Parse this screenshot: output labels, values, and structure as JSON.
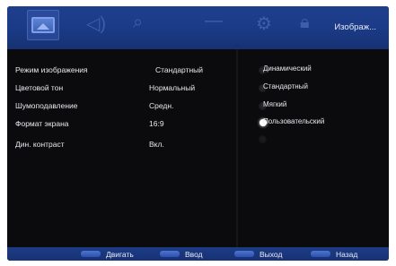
{
  "header": {
    "title": "Изображ..."
  },
  "settings": [
    {
      "label": "Режим изображения",
      "value": "Стандартный"
    },
    {
      "label": "Цветовой тон",
      "value": "Нормальный"
    },
    {
      "label": "Шумоподавление",
      "value": "Средн."
    },
    {
      "label": "Формат экрана",
      "value": "16:9"
    },
    {
      "label": "Дин. контраст",
      "value": "Вкл."
    }
  ],
  "options": [
    {
      "label": "Динамический",
      "selected": false
    },
    {
      "label": "Стандартный",
      "selected": false
    },
    {
      "label": "Мягкий",
      "selected": false
    },
    {
      "label": "Пользовательский",
      "selected": true
    }
  ],
  "footer": {
    "move": "Двигать",
    "enter": "Ввод",
    "exit": "Выход",
    "back": "Назад"
  }
}
